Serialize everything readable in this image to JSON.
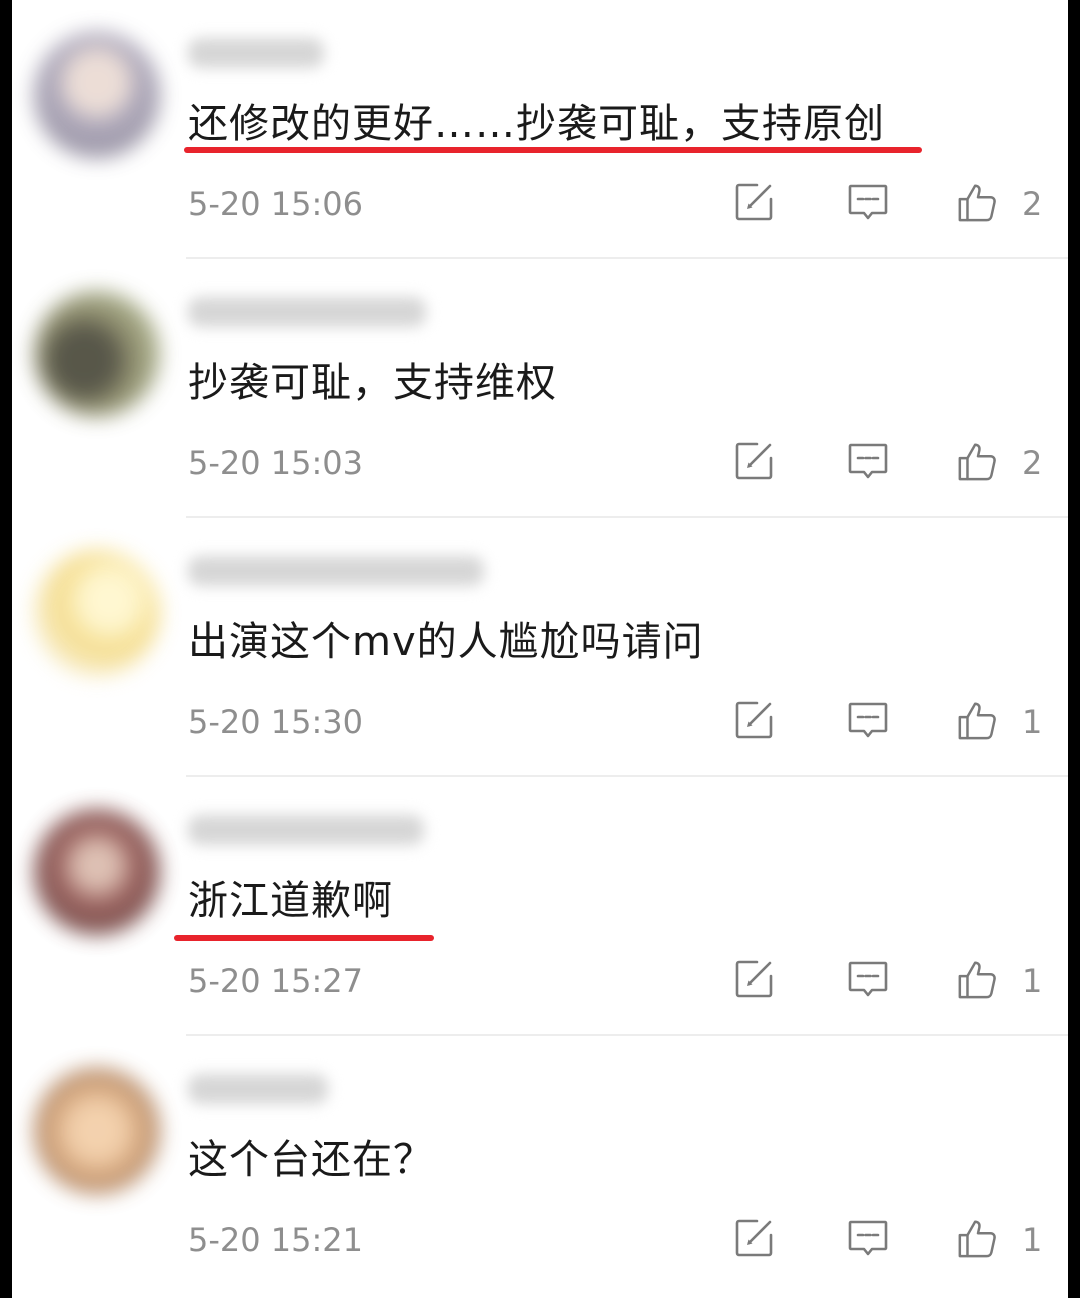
{
  "comments": [
    {
      "username": "████ ███",
      "text": "还修改的更好……抄袭可耻，支持原创",
      "time": "5-20 15:06",
      "likes": "2",
      "avatar_color": "#a9a2b6",
      "underlined": true
    },
    {
      "username": "██████ ███ ███",
      "text": "抄袭可耻，支持维权",
      "time": "5-20 15:03",
      "likes": "2",
      "avatar_color": "#5c5a3f",
      "underlined": false
    },
    {
      "username": "██████████████",
      "text": "出演这个mv的人尴尬吗请问",
      "time": "5-20 15:30",
      "likes": "1",
      "avatar_color": "#f3d77a",
      "underlined": false
    },
    {
      "username": "████████████",
      "text": "浙江道歉啊",
      "time": "5-20 15:27",
      "likes": "1",
      "avatar_color": "#8c4a46",
      "underlined": true
    },
    {
      "username": "██████",
      "text": "这个台还在？",
      "time": "5-20 15:21",
      "likes": "1",
      "avatar_color": "#cf9a6a",
      "underlined": false
    }
  ],
  "colors": {
    "underline": "#e8232c",
    "meta_text": "#8e8e8e",
    "content_text": "#1a1a1a"
  },
  "icons": {
    "edit": "edit-icon",
    "reply": "comment-icon",
    "like": "thumbs-up-icon"
  }
}
